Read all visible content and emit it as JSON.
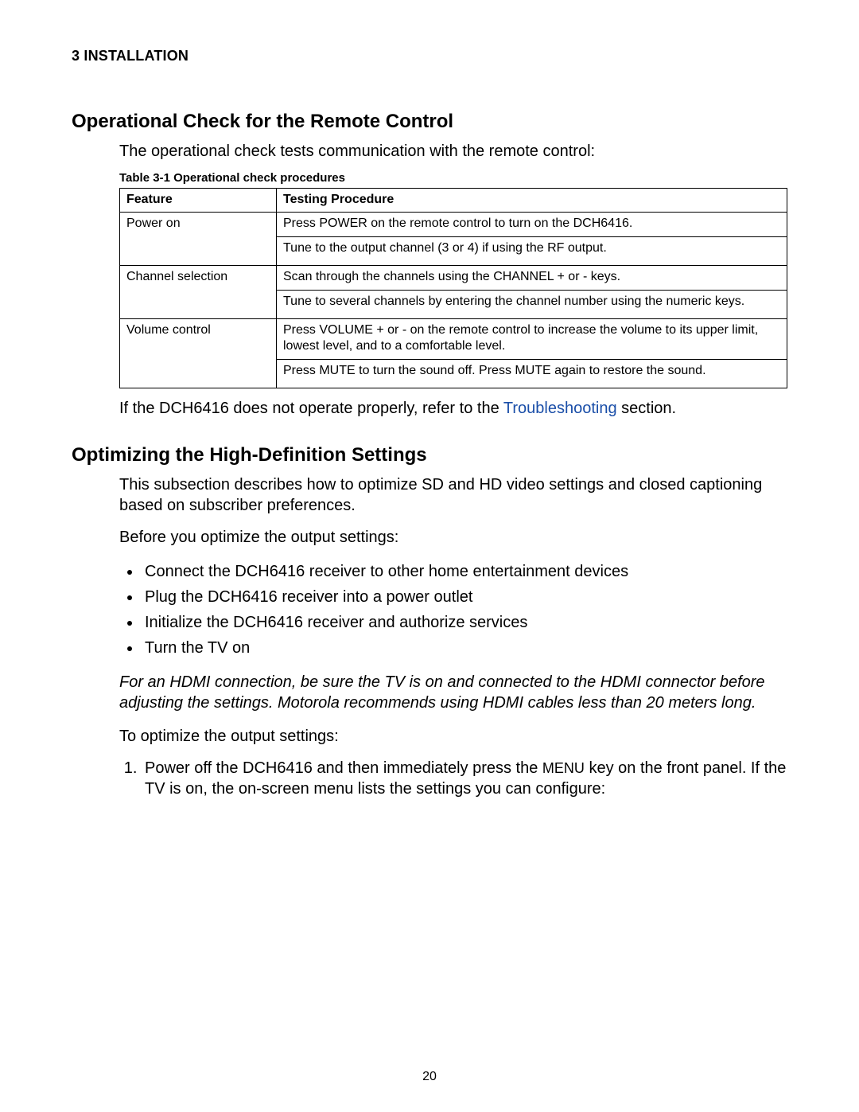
{
  "section_header": "3 INSTALLATION",
  "heading1": "Operational Check for the Remote Control",
  "intro1": "The operational check tests communication with the remote control:",
  "table_caption": "Table 3-1 Operational check procedures",
  "table": {
    "headers": [
      "Feature",
      "Testing Procedure"
    ],
    "rows": [
      {
        "feature": "Power on",
        "procedures": [
          "Press POWER on the remote control to turn on the DCH6416.",
          "Tune to the output channel (3 or 4) if using the RF output."
        ]
      },
      {
        "feature": "Channel selection",
        "procedures": [
          "Scan through the channels using the CHANNEL + or - keys.",
          "Tune to several channels by entering the channel number using the numeric keys."
        ]
      },
      {
        "feature": "Volume control",
        "procedures": [
          "Press VOLUME + or - on the remote control to increase the volume to its upper limit, lowest level, and to a comfortable level.",
          "Press MUTE to turn the sound off. Press MUTE again to restore the sound."
        ]
      }
    ]
  },
  "after_table_pre": "If the DCH6416 does not operate properly, refer to the ",
  "after_table_link": "Troubleshooting",
  "after_table_post": " section.",
  "heading2": "Optimizing the High-Definition Settings",
  "para_sub": "This subsection describes how to optimize SD and HD video settings and closed captioning based on subscriber preferences.",
  "para_before": "Before you optimize the output settings:",
  "bullets": [
    "Connect the DCH6416 receiver to other home entertainment devices",
    "Plug the DCH6416 receiver into a power outlet",
    "Initialize the DCH6416 receiver and authorize services",
    "Turn the TV on"
  ],
  "italic_note": "For an HDMI connection, be sure the TV is on and connected to the HDMI connector before adjusting the settings. Motorola recommends using HDMI cables less than 20 meters long.",
  "para_optimize": "To optimize the output settings:",
  "step1_pre": "Power off the DCH6416 and then immediately press the ",
  "step1_menu": "MENU",
  "step1_post": " key on the front panel. If the TV is on, the on-screen menu lists the settings you can configure:",
  "page_number": "20"
}
